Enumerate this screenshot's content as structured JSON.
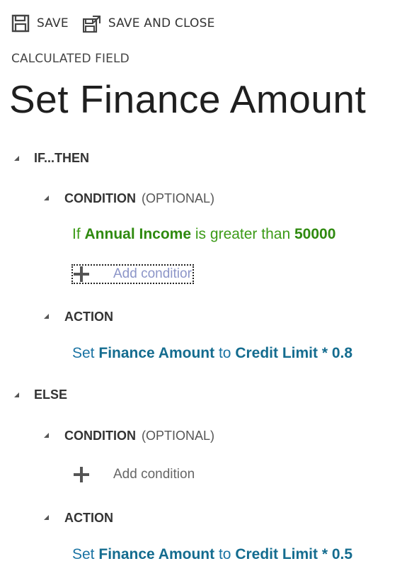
{
  "toolbar": {
    "save_label": "SAVE",
    "save_close_label": "SAVE AND CLOSE"
  },
  "entity_label": "CALCULATED FIELD",
  "title": "Set Finance Amount",
  "if_then": {
    "heading": "IF...THEN",
    "condition": {
      "heading": "CONDITION",
      "optional": "(OPTIONAL)",
      "rule": {
        "prefix": "If",
        "field": "Annual Income",
        "operator": "is greater than",
        "value": "50000"
      },
      "add_label": "Add conditior"
    },
    "action": {
      "heading": "ACTION",
      "rule": {
        "verb": "Set",
        "target": "Finance Amount",
        "connector": "to",
        "expression": "Credit Limit * 0.8"
      }
    }
  },
  "else": {
    "heading": "ELSE",
    "condition": {
      "heading": "CONDITION",
      "optional": "(OPTIONAL)",
      "add_label": "Add condition"
    },
    "action": {
      "heading": "ACTION",
      "rule": {
        "verb": "Set",
        "target": "Finance Amount",
        "connector": "to",
        "expression": "Credit Limit * 0.5"
      }
    }
  },
  "colors": {
    "condition_green": "#3b9a16",
    "action_blue": "#1a73a3",
    "focus_link": "#8c95c8"
  },
  "icons": {
    "save": "floppy-disk-icon",
    "save_close": "save-close-icon",
    "collapse": "collapse-caret-icon",
    "add": "plus-icon"
  }
}
